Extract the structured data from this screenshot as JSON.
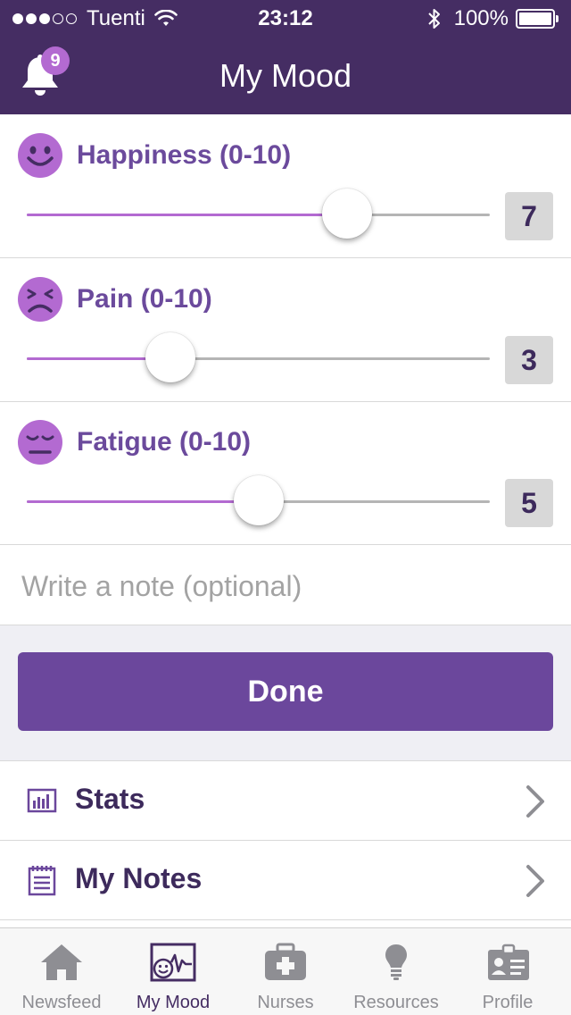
{
  "status_bar": {
    "carrier": "Tuenti",
    "time": "23:12",
    "battery": "100%"
  },
  "header": {
    "title": "My Mood",
    "notification_count": "9"
  },
  "moods": [
    {
      "label": "Happiness (0-10)",
      "value": "7",
      "level": 7,
      "max": 10,
      "face": "happy-face-icon"
    },
    {
      "label": "Pain (0-10)",
      "value": "3",
      "level": 3,
      "max": 10,
      "face": "pained-face-icon"
    },
    {
      "label": "Fatigue (0-10)",
      "value": "5",
      "level": 5,
      "max": 10,
      "face": "tired-face-icon"
    }
  ],
  "note": {
    "placeholder": "Write a note (optional)",
    "value": ""
  },
  "done_label": "Done",
  "links": [
    {
      "label": "Stats",
      "icon": "bar-chart-icon"
    },
    {
      "label": "My Notes",
      "icon": "notepad-icon"
    }
  ],
  "tabs": [
    {
      "label": "Newsfeed",
      "icon": "house-icon",
      "active": false
    },
    {
      "label": "My Mood",
      "icon": "mood-chart-icon",
      "active": true
    },
    {
      "label": "Nurses",
      "icon": "first-aid-kit-icon",
      "active": false
    },
    {
      "label": "Resources",
      "icon": "lightbulb-icon",
      "active": false
    },
    {
      "label": "Profile",
      "icon": "id-card-icon",
      "active": false
    }
  ],
  "colors": {
    "header_bg": "#452d63",
    "accent": "#b36ad1",
    "button": "#6b479c",
    "label": "#6b4a9c",
    "tab_inactive": "#8e8e93"
  }
}
